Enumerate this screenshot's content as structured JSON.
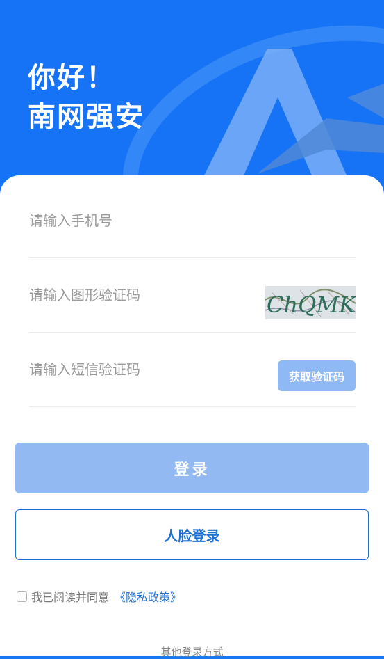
{
  "header": {
    "greeting_line1": "你好！",
    "greeting_line2": "南网强安"
  },
  "form": {
    "phone_placeholder": "请输入手机号",
    "captcha_placeholder": "请输入图形验证码",
    "captcha_text": "ChQMKq",
    "sms_placeholder": "请输入短信验证码",
    "sms_button": "获取验证码"
  },
  "actions": {
    "login": "登录",
    "face_login": "人脸登录"
  },
  "agreement": {
    "text": "我已阅读并同意",
    "link": "《隐私政策》"
  },
  "other_login": "其他登录方式",
  "colors": {
    "brand_blue": "#1673f5",
    "button_disabled": "#92b9f2",
    "link_blue": "#1c6fd3"
  }
}
